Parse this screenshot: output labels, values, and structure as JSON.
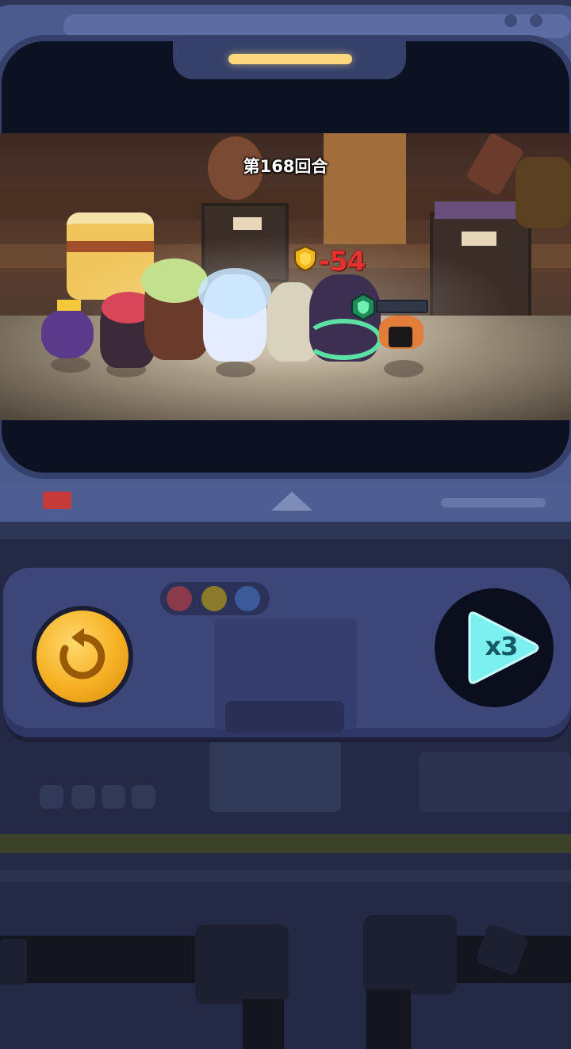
{
  "battle": {
    "round_label": "第168回合",
    "damage_number": "-54"
  },
  "controls": {
    "speed_label": "x3",
    "status_lights": [
      "#8a3a4a",
      "#8a7a2a",
      "#3a5a9a"
    ]
  },
  "icons": {
    "restart": "restart-arrow-icon",
    "speed": "play-triangle-icon",
    "shield_gold": "shield-icon",
    "shield_green": "shield-icon"
  },
  "colors": {
    "accent_gold": "#f6b023",
    "speed_cyan": "#7cf0f0",
    "damage_red": "#e6322e",
    "panel": "#3d4679"
  }
}
